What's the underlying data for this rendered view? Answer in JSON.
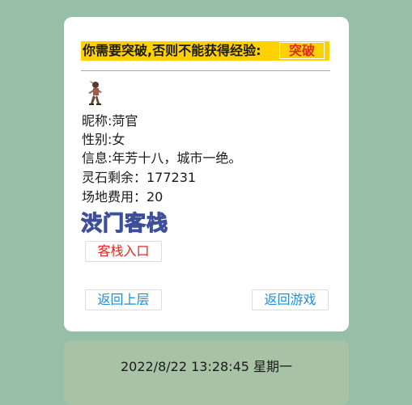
{
  "notice": {
    "text": "你需要突破,否则不能获得经验:",
    "button_label": "突破"
  },
  "profile": {
    "avatar": "character-sprite-icon",
    "nickname_line": "昵称:菏官",
    "gender_line": "性别:女",
    "info_line": "信息:年芳十八，城市一绝。",
    "spirit_stones_line": "灵石剩余：177231",
    "venue_fee_line": "场地费用：20"
  },
  "inn": {
    "logo_text": "渋门客栈",
    "entrance_label": "客栈入口"
  },
  "nav": {
    "back_label": "返回上层",
    "game_label": "返回游戏"
  },
  "footer": {
    "datetime": "2022/8/22 13:28:45 星期一"
  },
  "colors": {
    "page_background": "#97bfa8",
    "notice_background": "#ffd100",
    "accent_red": "#e0281f",
    "link_blue": "#1f8dd6",
    "footer_background": "#a8c2a6"
  }
}
